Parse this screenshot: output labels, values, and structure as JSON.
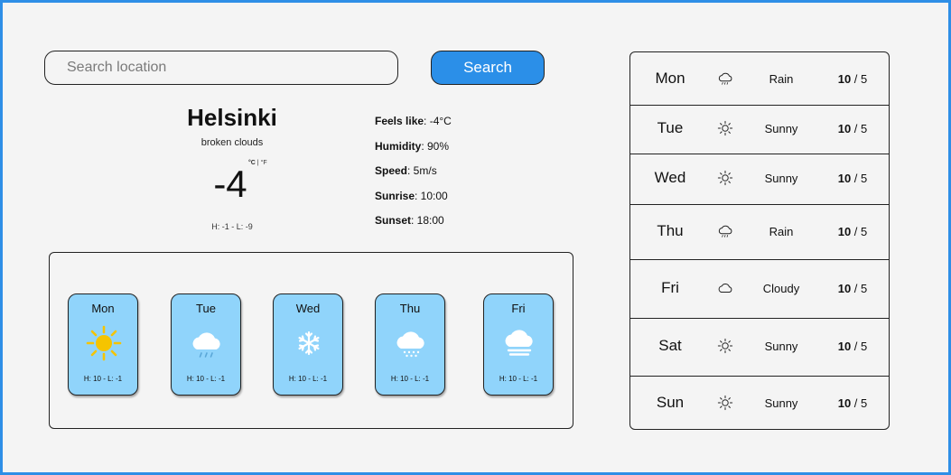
{
  "search": {
    "placeholder": "Search location",
    "button_label": "Search"
  },
  "current": {
    "city": "Helsinki",
    "description": "broken clouds",
    "temperature": "-4",
    "unit_c": "°C",
    "unit_sep": " | ",
    "unit_f": "°F",
    "high_low": "H: -1 - L: -9",
    "details": [
      {
        "label": "Feels like",
        "value": ": -4°C"
      },
      {
        "label": "Humidity",
        "value": ": 90%"
      },
      {
        "label": "Speed",
        "value": ": 5m/s"
      },
      {
        "label": "Sunrise",
        "value": ": 10:00"
      },
      {
        "label": "Sunset",
        "value": ": 18:00"
      }
    ]
  },
  "forecast_cards": [
    {
      "day": "Mon",
      "icon": "sun-icon",
      "high_low": "H: 10 - L: -1"
    },
    {
      "day": "Tue",
      "icon": "rain-cloud-icon",
      "high_low": "H: 10 - L: -1"
    },
    {
      "day": "Wed",
      "icon": "snowflake-icon",
      "high_low": "H: 10 - L: -1"
    },
    {
      "day": "Thu",
      "icon": "snow-cloud-icon",
      "high_low": "H: 10 - L: -1"
    },
    {
      "day": "Fri",
      "icon": "fog-cloud-icon",
      "high_low": "H: 10 - L: -1"
    }
  ],
  "weekly": [
    {
      "day": "Mon",
      "icon": "rain-icon",
      "condition": "Rain",
      "high": "10",
      "low": " / 5"
    },
    {
      "day": "Tue",
      "icon": "sun-outline-icon",
      "condition": "Sunny",
      "high": "10",
      "low": " / 5"
    },
    {
      "day": "Wed",
      "icon": "sun-outline-icon",
      "condition": "Sunny",
      "high": "10",
      "low": " / 5"
    },
    {
      "day": "Thu",
      "icon": "rain-icon",
      "condition": "Rain",
      "high": "10",
      "low": " / 5"
    },
    {
      "day": "Fri",
      "icon": "cloud-icon",
      "condition": "Cloudy",
      "high": "10",
      "low": " / 5"
    },
    {
      "day": "Sat",
      "icon": "sun-outline-icon",
      "condition": "Sunny",
      "high": "10",
      "low": " / 5"
    },
    {
      "day": "Sun",
      "icon": "sun-outline-icon",
      "condition": "Sunny",
      "high": "10",
      "low": " / 5"
    }
  ],
  "colors": {
    "frame_border": "#2e8ee6",
    "search_button": "#2b8fe8",
    "card_background": "#90d4fb",
    "sun": "#f5c400"
  }
}
